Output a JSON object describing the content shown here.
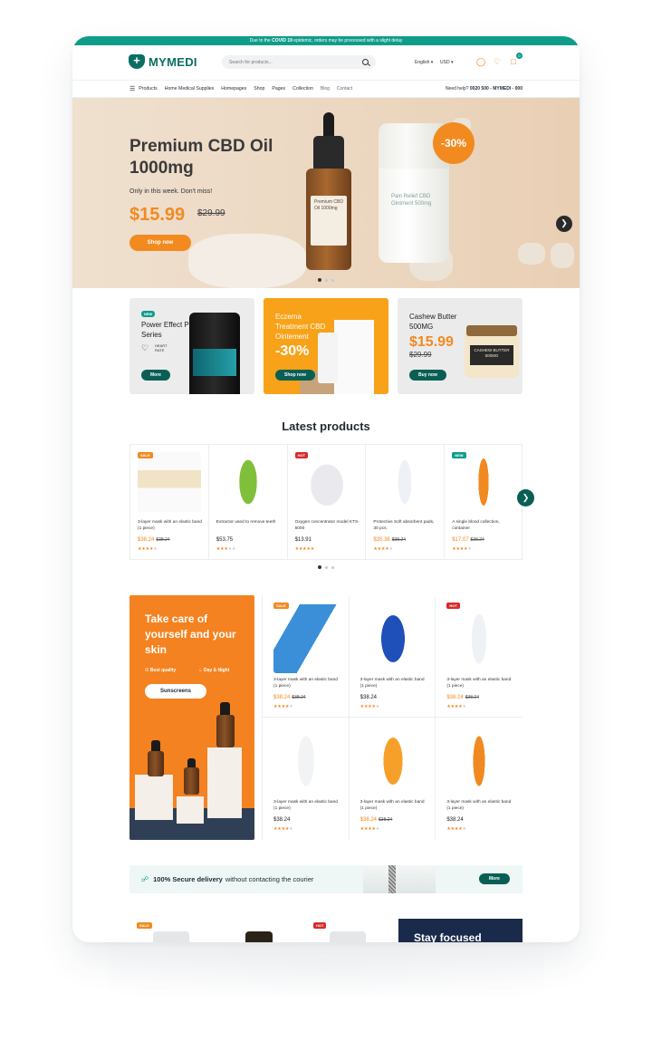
{
  "announcement": {
    "before": "Due to the ",
    "bold": "COVID 19",
    "after": " epidemic, orders may be processed with a slight delay"
  },
  "header": {
    "logo_text": "MYMEDI",
    "search_placeholder": "Search for products...",
    "language": "English",
    "currency": "USD",
    "cart_count": "0"
  },
  "nav": {
    "items": [
      "Products",
      "Home Medical Supplies",
      "Homepages",
      "Shop",
      "Pages",
      "Collection",
      "Blog",
      "Contact"
    ],
    "help_label": "Need help?",
    "help_phone": "0020 500 - MYMEDI - 000"
  },
  "hero": {
    "title": "Premium CBD Oil 1000mg",
    "subtitle": "Only in this week. Don't miss!",
    "price": "$15.99",
    "old_price": "$29.99",
    "button": "Shop now",
    "discount": "-30%",
    "bottle_label": "Premium CBD Oil 1000mg",
    "jar_label": "Pain Relief CBD Ointment 500mg"
  },
  "promos": [
    {
      "badge": "NEW",
      "title": "Power Effect Pro Series",
      "sub": "HEART RATE",
      "button": "More"
    },
    {
      "title": "Eczema Treatment CBD Ointement",
      "discount": "-30%",
      "button": "Shop now"
    },
    {
      "title": "Cashew Butter 500MG",
      "price": "$15.99",
      "old_price": "$29.99",
      "button": "Buy now",
      "jar_label": "CASHEW BUTTER 500MG"
    }
  ],
  "latest": {
    "title": "Latest products",
    "products": [
      {
        "tag": "SALE",
        "name": "3-layer mask with an elastic band (1 piece)",
        "price": "$38.24",
        "old": "$38.24",
        "rating": 4
      },
      {
        "tag": "",
        "name": "Extractor used to remove teeth",
        "price": "$53.75",
        "old": "",
        "rating": 3
      },
      {
        "tag": "HOT",
        "name": "Oxygen concentrator model KTS-5000",
        "price": "$13.91",
        "old": "",
        "rating": 5
      },
      {
        "tag": "",
        "name": "Protective Soft absorbent pads, 30 pcs.",
        "price": "$35.38",
        "old": "$38.24",
        "rating": 4
      },
      {
        "tag": "NEW",
        "name": "A single blood collection, container",
        "price": "$17.07",
        "old": "$38.24",
        "rating": 4
      }
    ]
  },
  "skin": {
    "title": "Take care of yourself and your skin",
    "feature_1": "Best quality",
    "feature_2": "Day & Night",
    "button": "Sunscreens"
  },
  "grid_products": [
    {
      "tag": "SALE",
      "name": "3-layer mask with an elastic band (1 piece)",
      "price": "$38.24",
      "old": "$38.24",
      "rating": 4
    },
    {
      "tag": "",
      "name": "3-layer mask with an elastic band (1 piece)",
      "price": "$38.24",
      "old": "",
      "rating": 4
    },
    {
      "tag": "HOT",
      "name": "3-layer mask with an elastic band (1 piece)",
      "price": "$38.24",
      "old": "$38.24",
      "rating": 4
    },
    {
      "tag": "",
      "name": "3-layer mask with an elastic band (1 piece)",
      "price": "$38.24",
      "old": "",
      "rating": 4
    },
    {
      "tag": "",
      "name": "3-layer mask with an elastic band (1 piece)",
      "price": "$38.24",
      "old": "$38.24",
      "rating": 4
    },
    {
      "tag": "",
      "name": "3-layer mask with an elastic band (1 piece)",
      "price": "$38.24",
      "old": "",
      "rating": 4
    }
  ],
  "delivery": {
    "bold": "100% Secure delivery",
    "text": "without contacting the courier",
    "button": "More"
  },
  "bottom": {
    "tag_1": "SALE",
    "tag_2": "HOT",
    "banner": "Stay focused"
  },
  "colors": {
    "brand": "#0a6e63",
    "accent": "#f28a20",
    "teal": "#0f9d8a"
  }
}
